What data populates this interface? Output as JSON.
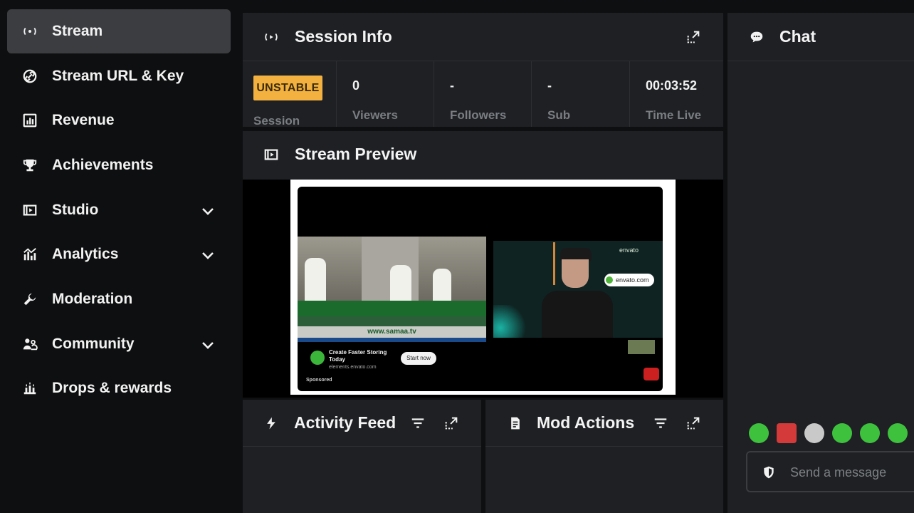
{
  "sidebar": {
    "items": [
      {
        "label": "Stream",
        "icon": "broadcast-icon",
        "active": true,
        "expandable": false
      },
      {
        "label": "Stream URL & Key",
        "icon": "link-icon",
        "active": false,
        "expandable": false
      },
      {
        "label": "Revenue",
        "icon": "bar-chart-icon",
        "active": false,
        "expandable": false
      },
      {
        "label": "Achievements",
        "icon": "trophy-icon",
        "active": false,
        "expandable": false
      },
      {
        "label": "Studio",
        "icon": "studio-icon",
        "active": false,
        "expandable": true
      },
      {
        "label": "Analytics",
        "icon": "analytics-icon",
        "active": false,
        "expandable": true
      },
      {
        "label": "Moderation",
        "icon": "wrench-icon",
        "active": false,
        "expandable": false
      },
      {
        "label": "Community",
        "icon": "community-icon",
        "active": false,
        "expandable": true
      },
      {
        "label": "Drops & rewards",
        "icon": "drops-icon",
        "active": false,
        "expandable": false
      }
    ]
  },
  "session_info": {
    "title": "Session Info",
    "status_badge": "UNSTABLE",
    "status_label": "Session",
    "stats": [
      {
        "value": "0",
        "label": "Viewers"
      },
      {
        "value": "-",
        "label": "Followers"
      },
      {
        "value": "-",
        "label": "Sub"
      },
      {
        "value": "00:03:52",
        "label": "Time Live"
      }
    ]
  },
  "stream_preview": {
    "title": "Stream Preview",
    "video": {
      "news_url": "www.samaa.tv",
      "ad_title": "Create Faster Storing Today",
      "ad_domain": "elements.envato.com",
      "ad_button": "Start now",
      "sponsored": "Sponsored",
      "envato_badge": "envato.com",
      "envato_logo": "envato"
    }
  },
  "activity_feed": {
    "title": "Activity Feed"
  },
  "mod_actions": {
    "title": "Mod Actions"
  },
  "chat": {
    "title": "Chat",
    "input_placeholder": "Send a message",
    "emote_colors": [
      "#3ec23e",
      "#d43a3a",
      "#c9c9c9",
      "#3ec23e",
      "#3ec23e",
      "#3ec23e"
    ]
  },
  "colors": {
    "accent_badge": "#f3b23f",
    "panel_bg": "#1e2023",
    "page_bg": "#0e0f10",
    "active_nav": "#3b3d41"
  }
}
